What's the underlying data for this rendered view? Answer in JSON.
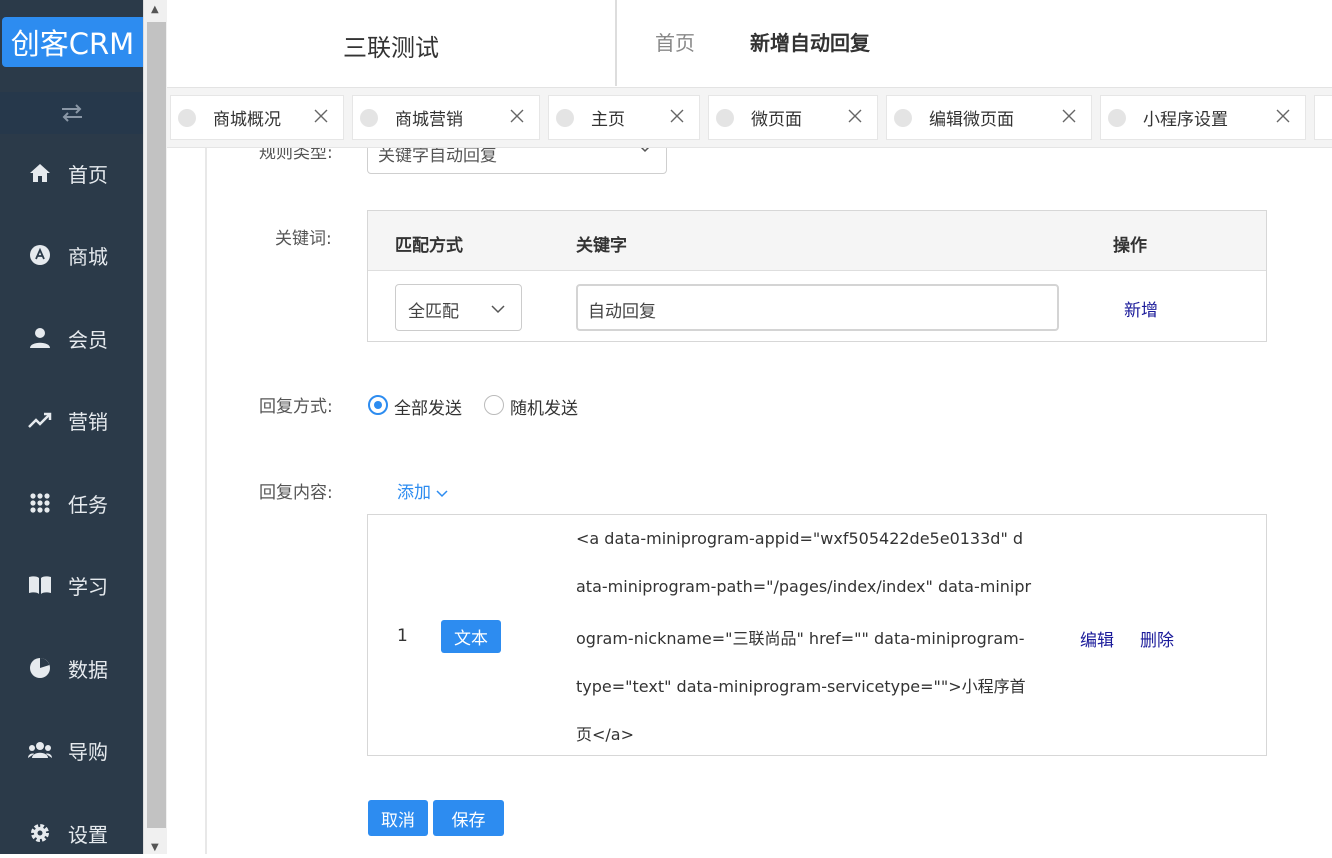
{
  "app": {
    "logo": "创客CRM",
    "store_name": "三联测试"
  },
  "breadcrumb": {
    "home": "首页",
    "current": "新增自动回复"
  },
  "sidebar": {
    "items": [
      {
        "label": "首页",
        "icon": "home-icon"
      },
      {
        "label": "商城",
        "icon": "store-icon"
      },
      {
        "label": "会员",
        "icon": "user-icon"
      },
      {
        "label": "营销",
        "icon": "trend-icon"
      },
      {
        "label": "任务",
        "icon": "grid-icon"
      },
      {
        "label": "学习",
        "icon": "book-icon"
      },
      {
        "label": "数据",
        "icon": "pie-icon"
      },
      {
        "label": "导购",
        "icon": "group-icon"
      },
      {
        "label": "设置",
        "icon": "gear-icon"
      }
    ]
  },
  "tabs": [
    {
      "label": "商城概况"
    },
    {
      "label": "商城营销"
    },
    {
      "label": "主页"
    },
    {
      "label": "微页面"
    },
    {
      "label": "编辑微页面"
    },
    {
      "label": "小程序设置"
    }
  ],
  "form": {
    "rule_type_label": "规则类型:",
    "rule_type_value": "关键字自动回复",
    "keyword_label": "关键词:",
    "keyword_table": {
      "headers": [
        "匹配方式",
        "关键字",
        "操作"
      ],
      "row": {
        "match": "全匹配",
        "keyword": "自动回复",
        "action": "新增"
      }
    },
    "reply_mode_label": "回复方式:",
    "reply_modes": [
      {
        "label": "全部发送",
        "selected": true
      },
      {
        "label": "随机发送",
        "selected": false
      }
    ],
    "reply_content_label": "回复内容:",
    "add_label": "添加",
    "content_row": {
      "index": "1",
      "type": "文本",
      "lines": [
        "<a data-miniprogram-appid=\"wxf505422de5e0133d\" d",
        "ata-miniprogram-path=\"/pages/index/index\" data-minipr",
        "ogram-nickname=\"三联尚品\" href=\"\" data-miniprogram-",
        "type=\"text\" data-miniprogram-servicetype=\"\">小程序首",
        "页</a>"
      ],
      "edit": "编辑",
      "delete": "删除"
    },
    "cancel": "取消",
    "save": "保存"
  },
  "colors": {
    "sidebar": "#2b3a49",
    "accent": "#2d8cf0"
  }
}
